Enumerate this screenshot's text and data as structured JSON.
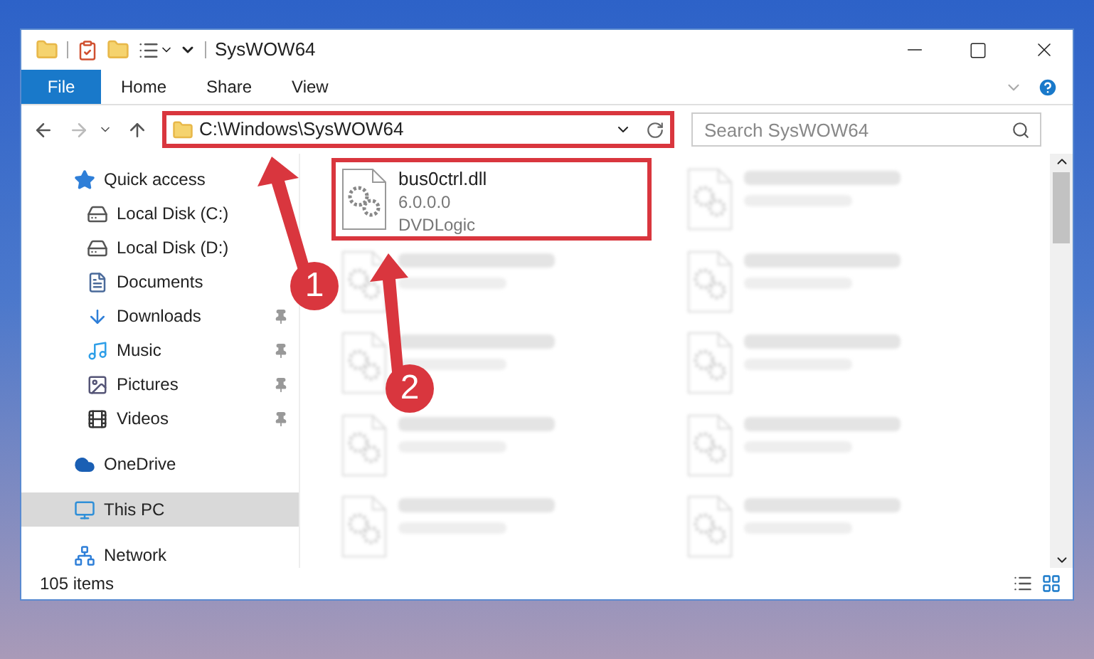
{
  "window": {
    "title": "SysWOW64"
  },
  "ribbon_tabs": [
    {
      "label": "File",
      "kind": "file"
    },
    {
      "label": "Home",
      "kind": "tab"
    },
    {
      "label": "Share",
      "kind": "tab"
    },
    {
      "label": "View",
      "kind": "tab"
    }
  ],
  "address_bar": {
    "path": "C:\\Windows\\SysWOW64",
    "highlighted": true
  },
  "search": {
    "placeholder": "Search SysWOW64"
  },
  "sidebar": {
    "items": [
      {
        "label": "Quick access",
        "kind": "quick",
        "selected": false,
        "children": [
          {
            "label": "Local Disk (C:)",
            "kind": "diskc",
            "pinned": false
          },
          {
            "label": "Local Disk (D:)",
            "kind": "disk",
            "pinned": false
          },
          {
            "label": "Documents",
            "kind": "docs",
            "pinned": false
          },
          {
            "label": "Downloads",
            "kind": "downloads",
            "pinned": true
          },
          {
            "label": "Music",
            "kind": "music",
            "pinned": true
          },
          {
            "label": "Pictures",
            "kind": "pictures",
            "pinned": true
          },
          {
            "label": "Videos",
            "kind": "videos",
            "pinned": true
          }
        ]
      },
      {
        "label": "OneDrive",
        "kind": "cloud",
        "selected": false
      },
      {
        "label": "This PC",
        "kind": "pc",
        "selected": true
      },
      {
        "label": "Network",
        "kind": "network",
        "selected": false
      }
    ]
  },
  "files": [
    {
      "kind": "file",
      "name": "bus0ctrl.dll",
      "lines": [
        "6.0.0.0",
        "DVDLogic"
      ],
      "highlighted": true
    },
    {
      "kind": "blurred"
    },
    {
      "kind": "blurred"
    },
    {
      "kind": "blurred"
    },
    {
      "kind": "blurred"
    },
    {
      "kind": "blurred"
    },
    {
      "kind": "blurred"
    },
    {
      "kind": "blurred"
    },
    {
      "kind": "blurred"
    },
    {
      "kind": "blurred"
    }
  ],
  "status_bar": {
    "count": "105 items"
  },
  "annotations": [
    {
      "number": "1"
    },
    {
      "number": "2"
    }
  ]
}
